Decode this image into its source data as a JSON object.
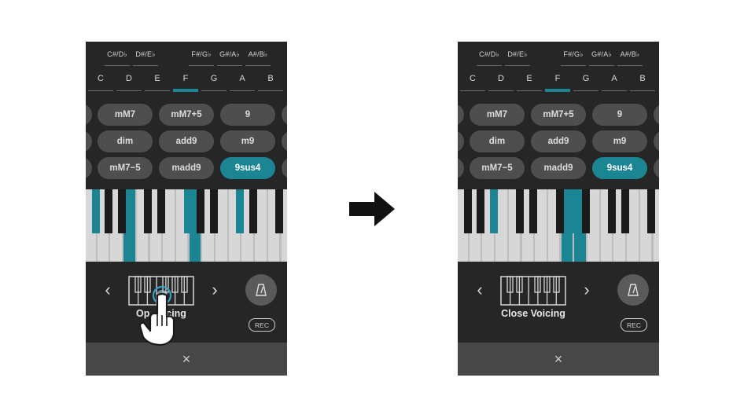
{
  "sharp_notes": [
    "C#/D♭",
    "D#/E♭",
    "F#/G♭",
    "G#/A♭",
    "A#/B♭"
  ],
  "notes": [
    "C",
    "D",
    "E",
    "F",
    "G",
    "A",
    "B"
  ],
  "selected_note": "F",
  "chord_rows": [
    [
      "mM7",
      "mM7+5",
      "9"
    ],
    [
      "dim",
      "add9",
      "m9"
    ],
    [
      "mM7−5",
      "madd9",
      "9sus4"
    ]
  ],
  "selected_chord": "9sus4",
  "panels": [
    {
      "voicing_label": "Open Voicing",
      "voicing_label_visible": "Op     icing",
      "highlighted_keys": [
        "F",
        "Bb",
        "C",
        "Eb",
        "G"
      ]
    },
    {
      "voicing_label": "Close Voicing",
      "highlighted_keys": [
        "Bb",
        "C",
        "Eb",
        "F",
        "G"
      ]
    }
  ],
  "prev_label": "‹",
  "next_label": "›",
  "rec_label": "REC",
  "close_label": "×",
  "colors": {
    "accent": "#1b8593",
    "background": "#262626",
    "chip": "#4e4e4e",
    "bottom_bar": "#474747"
  },
  "icons": {
    "metronome": "metronome-icon",
    "voicing": "piano-keys-icon",
    "hand": "tap-hand-icon",
    "arrow": "right-arrow-icon"
  }
}
